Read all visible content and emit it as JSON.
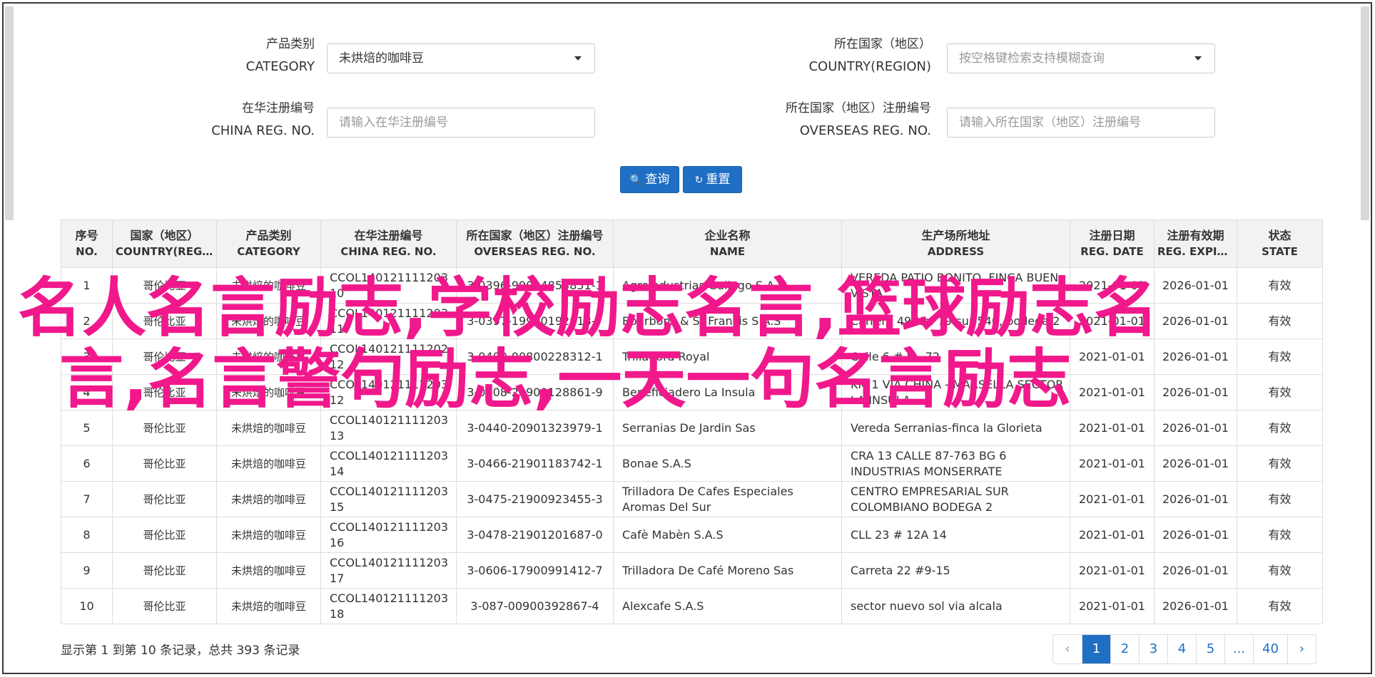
{
  "filters": {
    "category": {
      "label_zh": "产品类别",
      "label_en": "CATEGORY",
      "value": "未烘焙的咖啡豆"
    },
    "country": {
      "label_zh": "所在国家（地区）",
      "label_en": "COUNTRY(REGION)",
      "placeholder": "按空格键检索支持模糊查询"
    },
    "china_reg": {
      "label_zh": "在华注册编号",
      "label_en": "CHINA REG. NO.",
      "placeholder": "请输入在华注册编号"
    },
    "overseas_reg": {
      "label_zh": "所在国家（地区）注册编号",
      "label_en": "OVERSEAS REG. NO.",
      "placeholder": "请输入所在国家（地区）注册编号"
    },
    "search_label": "查询",
    "reset_label": "重置"
  },
  "table": {
    "headers": [
      {
        "zh": "序号",
        "en": "NO."
      },
      {
        "zh": "国家（地区）",
        "en": "COUNTRY(REGIO..."
      },
      {
        "zh": "产品类别",
        "en": "CATEGORY"
      },
      {
        "zh": "在华注册编号",
        "en": "CHINA REG. NO."
      },
      {
        "zh": "所在国家（地区）注册编号",
        "en": "OVERSEAS REG. NO."
      },
      {
        "zh": "企业名称",
        "en": "NAME"
      },
      {
        "zh": "生产场所地址",
        "en": "ADDRESS"
      },
      {
        "zh": "注册日期",
        "en": "REG. DATE"
      },
      {
        "zh": "注册有效期",
        "en": "REG. EXPIRE ..."
      },
      {
        "zh": "状态",
        "en": "STATE"
      }
    ],
    "rows": [
      {
        "no": "1",
        "country": "哥伦比亚",
        "category": "未烘焙的咖啡豆",
        "china_reg": "CCOL140121111203 10",
        "overseas_reg": "3-0396-99004853851-1",
        "name": "Agroindustrias Gallego S.A.S",
        "address": "VEREDA PATIO BONITO, FINCA BUEN VISTA",
        "reg_date": "2021-01-01",
        "expire": "2026-01-01",
        "state": "有效"
      },
      {
        "no": "2",
        "country": "哥伦比亚",
        "category": "未烘焙的咖啡豆",
        "china_reg": "CCOL140121111203 11",
        "overseas_reg": "3-0397-19900192018-7",
        "name": "Bourbons & St Francis S.A.S",
        "address": "Carrera 49 No. 79 sur 540, bodega 2",
        "reg_date": "2021-01-01",
        "expire": "2026-01-01",
        "state": "有效"
      },
      {
        "no": "3",
        "country": "哥伦比亚",
        "category": "未烘焙的咖啡豆",
        "china_reg": "CCOL140121111202 12",
        "overseas_reg": "3-0400-00800228312-1",
        "name": "Trilladora Royal",
        "address": "Calle 6 # 8 - 72",
        "reg_date": "2021-01-01",
        "expire": "2026-01-01",
        "state": "有效"
      },
      {
        "no": "4",
        "country": "哥伦比亚",
        "category": "未烘焙的咖啡豆",
        "china_reg": "CCOL140121111203 12",
        "overseas_reg": "3-0408-20900128861-9",
        "name": "Beneficiadero La Insula",
        "address": "KM 1 VÍA CHINA - MARSELLA SECTOR LA INSULA",
        "reg_date": "2021-01-01",
        "expire": "2026-01-01",
        "state": "有效"
      },
      {
        "no": "5",
        "country": "哥伦比亚",
        "category": "未烘焙的咖啡豆",
        "china_reg": "CCOL140121111203 13",
        "overseas_reg": "3-0440-20901323979-1",
        "name": "Serranias De Jardin Sas",
        "address": "Vereda Serranias-finca la Glorieta",
        "reg_date": "2021-01-01",
        "expire": "2026-01-01",
        "state": "有效"
      },
      {
        "no": "6",
        "country": "哥伦比亚",
        "category": "未烘焙的咖啡豆",
        "china_reg": "CCOL140121111203 14",
        "overseas_reg": "3-0466-21901183742-1",
        "name": "Bonae S.A.S",
        "address": "CRA 13 CALLE 87-763 BG 6 INDUSTRIAS MONSERRATE",
        "reg_date": "2021-01-01",
        "expire": "2026-01-01",
        "state": "有效"
      },
      {
        "no": "7",
        "country": "哥伦比亚",
        "category": "未烘焙的咖啡豆",
        "china_reg": "CCOL140121111203 15",
        "overseas_reg": "3-0475-21900923455-3",
        "name": "Trilladora De Cafes Especiales Aromas Del Sur",
        "address": "CENTRO EMPRESARIAL SUR COLOMBIANO BODEGA 2",
        "reg_date": "2021-01-01",
        "expire": "2026-01-01",
        "state": "有效"
      },
      {
        "no": "8",
        "country": "哥伦比亚",
        "category": "未烘焙的咖啡豆",
        "china_reg": "CCOL140121111203 16",
        "overseas_reg": "3-0478-21901201687-0",
        "name": "Cafè Mabèn S.A.S",
        "address": "CLL 23 # 12A 14",
        "reg_date": "2021-01-01",
        "expire": "2026-01-01",
        "state": "有效"
      },
      {
        "no": "9",
        "country": "哥伦比亚",
        "category": "未烘焙的咖啡豆",
        "china_reg": "CCOL140121111203 17",
        "overseas_reg": "3-0606-17900991412-7",
        "name": "Trilladora De Café Moreno Sas",
        "address": "Carreta 22 #9-15",
        "reg_date": "2021-01-01",
        "expire": "2026-01-01",
        "state": "有效"
      },
      {
        "no": "10",
        "country": "哥伦比亚",
        "category": "未烘焙的咖啡豆",
        "china_reg": "CCOL140121111203 18",
        "overseas_reg": "3-087-00900392867-4",
        "name": "Alexcafe S.A.S",
        "address": "sector nuevo sol via alcala",
        "reg_date": "2021-01-01",
        "expire": "2026-01-01",
        "state": "有效"
      }
    ]
  },
  "summary": "显示第 1 到第 10 条记录，总共 393 条记录",
  "pagination": {
    "prev": "‹",
    "pages": [
      "1",
      "2",
      "3",
      "4",
      "5",
      "...",
      "40"
    ],
    "next": "›",
    "active": "1"
  },
  "watermark": {
    "line1": "名人名言励志,学校励志名言,篮球励志名",
    "line2": "言,名言警句励志,一天一句名言励志",
    "color": "#f1188c"
  },
  "colors": {
    "primary": "#1f6fc4"
  }
}
